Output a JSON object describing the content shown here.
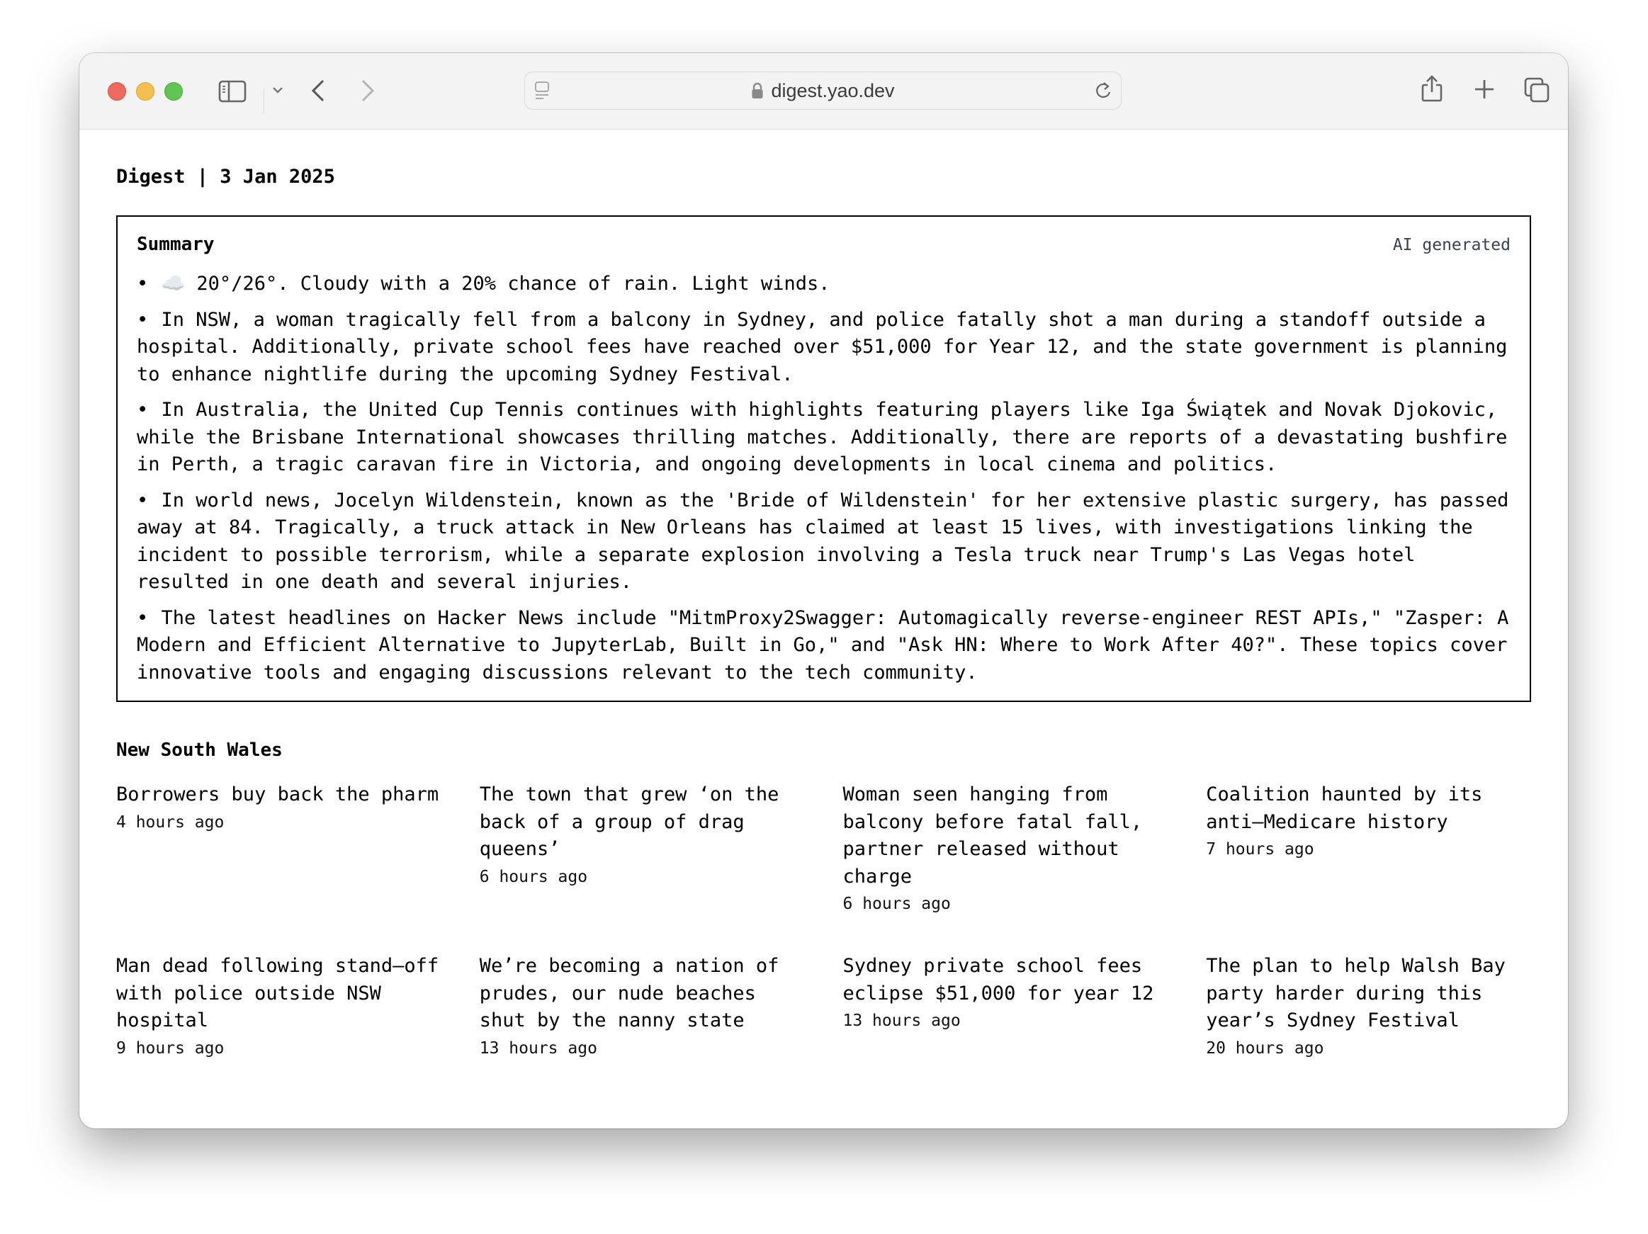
{
  "browser": {
    "url": "digest.yao.dev",
    "icons": {
      "close": "traffic-close",
      "minimize": "traffic-minimize",
      "zoom": "traffic-zoom",
      "sidebar": "sidebar-icon",
      "sidebar_menu": "chevron-down-icon",
      "back": "chevron-left-icon",
      "forward": "chevron-right-icon",
      "page_menu": "page-menu-icon",
      "lock": "lock-icon",
      "reload": "reload-icon",
      "share": "share-icon",
      "new_tab": "plus-icon",
      "tabs": "tab-overview-icon"
    }
  },
  "page": {
    "title": "Digest | 3 Jan 2025"
  },
  "summary": {
    "title": "Summary",
    "badge": "AI generated",
    "weather": {
      "icon": "☁️",
      "text": "20°/26°. Cloudy with a 20% chance of rain. Light winds."
    },
    "bullet": "•",
    "items": [
      "In NSW, a woman tragically fell from a balcony in Sydney, and police fatally shot a man during a standoff outside a hospital. Additionally, private school fees have reached over $51,000 for Year 12, and the state government is planning to enhance nightlife during the upcoming Sydney Festival.",
      "In Australia, the United Cup Tennis continues with highlights featuring players like Iga Świątek and Novak Djokovic, while the Brisbane International showcases thrilling matches. Additionally, there are reports of a devastating bushfire in Perth, a tragic caravan fire in Victoria, and ongoing developments in local cinema and politics.",
      "In world news, Jocelyn Wildenstein, known as the 'Bride of Wildenstein' for her extensive plastic surgery, has passed away at 84. Tragically, a truck attack in New Orleans has claimed at least 15 lives, with investigations linking the incident to possible terrorism, while a separate explosion involving a Tesla truck near Trump's Las Vegas hotel resulted in one death and several injuries.",
      "The latest headlines on Hacker News include \"MitmProxy2Swagger: Automagically reverse-engineer REST APIs,\" \"Zasper: A Modern and Efficient Alternative to JupyterLab, Built in Go,\" and \"Ask HN: Where to Work After 40?\". These topics cover innovative tools and engaging discussions relevant to the tech community."
    ]
  },
  "sections": [
    {
      "title": "New South Wales",
      "articles": [
        {
          "title": "Borrowers buy back the pharm",
          "time": "4 hours ago"
        },
        {
          "title": "The town that grew ‘on the back of a group of drag queens’",
          "time": "6 hours ago"
        },
        {
          "title": "Woman seen hanging from balcony before fatal fall, partner released without charge",
          "time": "6 hours ago"
        },
        {
          "title": "Coalition haunted by its anti–Medicare history",
          "time": "7 hours ago"
        },
        {
          "title": "Man dead following stand–off with police outside NSW hospital",
          "time": "9 hours ago"
        },
        {
          "title": "We’re becoming a nation of prudes, our nude beaches shut by the nanny state",
          "time": "13 hours ago"
        },
        {
          "title": "Sydney private school fees eclipse $51,000 for year 12",
          "time": "13 hours ago"
        },
        {
          "title": "The plan to help Walsh Bay party harder during this year’s Sydney Festival",
          "time": "20 hours ago"
        }
      ]
    }
  ]
}
